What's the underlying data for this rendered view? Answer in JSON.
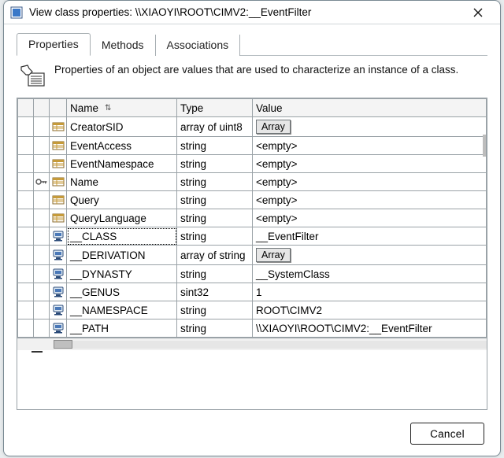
{
  "window": {
    "title": "View class properties: \\\\XIAOYI\\ROOT\\CIMV2:__EventFilter"
  },
  "tabs": {
    "items": [
      "Properties",
      "Methods",
      "Associations"
    ],
    "active_index": 0
  },
  "description": "Properties of an object are values that are used to characterize an instance of a class.",
  "columns": {
    "name": "Name",
    "type": "Type",
    "value": "Value",
    "sort_glyph": "⇅"
  },
  "labels": {
    "array_button": "Array",
    "empty": "<empty>"
  },
  "rows": [
    {
      "kind": "prop",
      "name": "CreatorSID",
      "type": "array of uint8",
      "value_mode": "array"
    },
    {
      "kind": "prop",
      "name": "EventAccess",
      "type": "string",
      "value_mode": "empty"
    },
    {
      "kind": "prop",
      "name": "EventNamespace",
      "type": "string",
      "value_mode": "empty"
    },
    {
      "kind": "prop",
      "name": "Name",
      "type": "string",
      "value_mode": "empty",
      "key": true
    },
    {
      "kind": "prop",
      "name": "Query",
      "type": "string",
      "value_mode": "empty"
    },
    {
      "kind": "prop",
      "name": "QueryLanguage",
      "type": "string",
      "value_mode": "empty"
    },
    {
      "kind": "sys",
      "name": "__CLASS",
      "type": "string",
      "value_mode": "text",
      "value": "__EventFilter",
      "selected": true
    },
    {
      "kind": "sys",
      "name": "__DERIVATION",
      "type": "array of string",
      "value_mode": "array"
    },
    {
      "kind": "sys",
      "name": "__DYNASTY",
      "type": "string",
      "value_mode": "text",
      "value": "__SystemClass"
    },
    {
      "kind": "sys",
      "name": "__GENUS",
      "type": "sint32",
      "value_mode": "text",
      "value": "1"
    },
    {
      "kind": "sys",
      "name": "__NAMESPACE",
      "type": "string",
      "value_mode": "text",
      "value": "ROOT\\CIMV2"
    },
    {
      "kind": "sys",
      "name": "__PATH",
      "type": "string",
      "value_mode": "text",
      "value": "\\\\XIAOYI\\ROOT\\CIMV2:__EventFilter"
    }
  ],
  "buttons": {
    "cancel": "Cancel"
  }
}
